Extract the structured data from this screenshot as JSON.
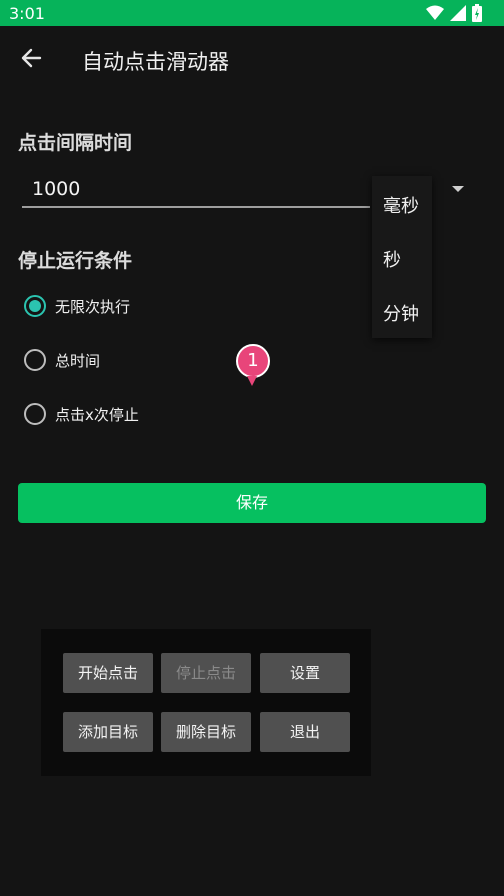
{
  "status_bar": {
    "time": "3:01",
    "icons": [
      "wifi-icon",
      "signal-icon",
      "battery-icon"
    ]
  },
  "toolbar": {
    "back_icon": "arrow-left-icon",
    "title": "自动点击滑动器"
  },
  "interval": {
    "label": "点击间隔时间",
    "value": "1000",
    "unit_options": [
      "毫秒",
      "秒",
      "分钟"
    ]
  },
  "stop_condition": {
    "label": "停止运行条件",
    "options": [
      {
        "label": "无限次执行",
        "checked": true
      },
      {
        "label": "总时间",
        "checked": false
      },
      {
        "label": "点击x次停止",
        "checked": false
      }
    ]
  },
  "target_marker": {
    "number": "1",
    "color": "#e8457a"
  },
  "save": {
    "label": "保存",
    "color": "#06c060"
  },
  "control_panel": {
    "buttons": [
      {
        "label": "开始点击",
        "enabled": true
      },
      {
        "label": "停止点击",
        "enabled": false
      },
      {
        "label": "设置",
        "enabled": true
      },
      {
        "label": "添加目标",
        "enabled": true
      },
      {
        "label": "删除目标",
        "enabled": true
      },
      {
        "label": "退出",
        "enabled": true
      }
    ]
  }
}
